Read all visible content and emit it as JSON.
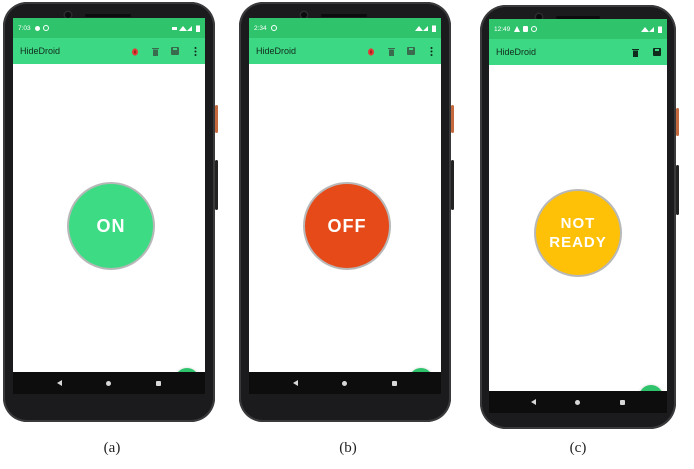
{
  "panels": [
    {
      "caption": "(a)",
      "status_time": "7:03",
      "app_title": "HideDroid",
      "state_label": "ON",
      "state_color": "#3ddc84",
      "fab_label": "+",
      "actions": [
        "bug-icon",
        "delete-icon",
        "save-icon",
        "more-icon"
      ]
    },
    {
      "caption": "(b)",
      "status_time": "2:34",
      "app_title": "HideDroid",
      "state_label": "OFF",
      "state_color": "#e64a19",
      "fab_label": "+",
      "actions": [
        "bug-icon",
        "delete-icon",
        "save-icon",
        "more-icon"
      ]
    },
    {
      "caption": "(c)",
      "status_time": "12:49",
      "app_title": "HideDroid",
      "state_label_line1": "NOT",
      "state_label_line2": "READY",
      "state_color": "#ffc107",
      "fab_label": "+",
      "actions": [
        "delete-icon",
        "save-icon"
      ]
    }
  ]
}
